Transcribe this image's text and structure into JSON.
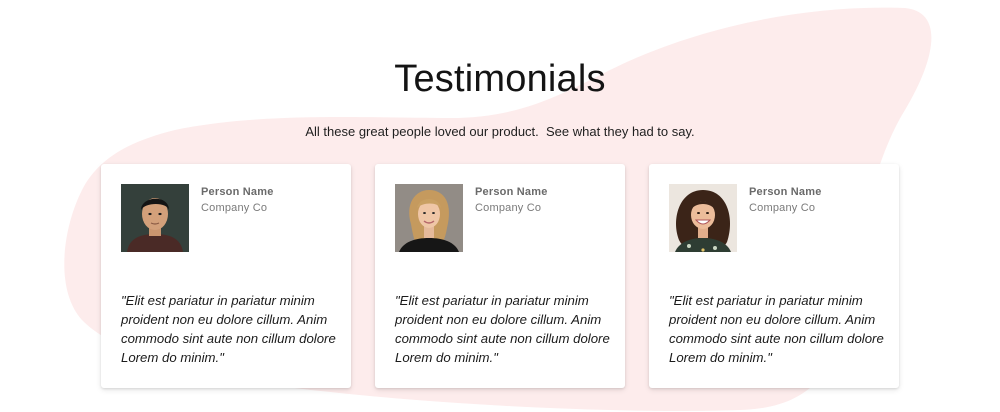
{
  "header": {
    "title": "Testimonials",
    "subtitle": "All these great people loved our product.  See what they had to say."
  },
  "testimonials": [
    {
      "name": "Person Name",
      "company": "Company Co",
      "quote": "\"Elit est pariatur in pariatur minim proident non eu dolore cillum. Anim commodo sint aute non cillum dolore Lorem do minim.\""
    },
    {
      "name": "Person Name",
      "company": "Company Co",
      "quote": "\"Elit est pariatur in pariatur minim proident non eu dolore cillum. Anim commodo sint aute non cillum dolore Lorem do minim.\""
    },
    {
      "name": "Person Name",
      "company": "Company Co",
      "quote": "\"Elit est pariatur in pariatur minim proident non eu dolore cillum. Anim commodo sint aute non cillum dolore Lorem do minim.\""
    }
  ],
  "colors": {
    "blob": "#fdecec",
    "card_background": "#ffffff",
    "name_text": "#6a6a6a"
  }
}
